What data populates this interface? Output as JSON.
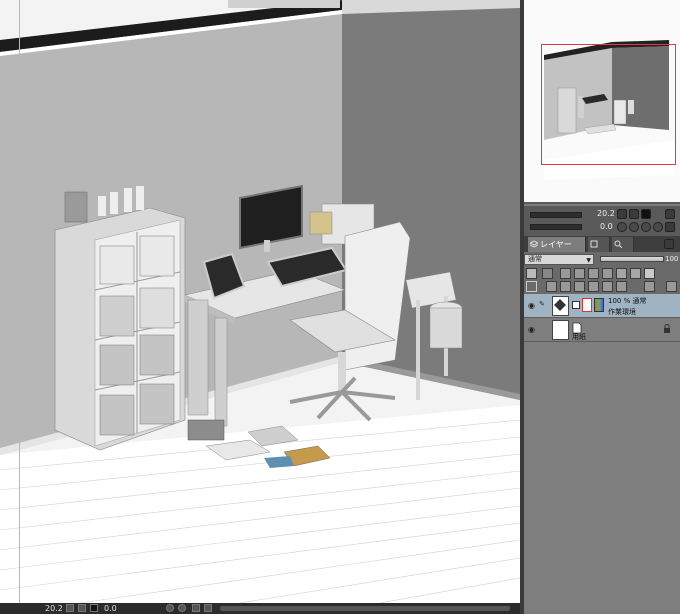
{
  "colors": {
    "canvas_bg": "#f3f3f3",
    "panel_bg": "#7d7d7d",
    "selected_layer": "#9fb3c2",
    "nav_frame": "#e23b3b"
  },
  "statusbar": {
    "zoom": "20.2",
    "rotation": "0.0"
  },
  "navigator": {
    "zoom": "20.2",
    "rotation": "0.0"
  },
  "tabs": [
    {
      "label": "レイヤー",
      "icon": "layers-icon"
    },
    {
      "label": "",
      "icon": "layer-property-icon"
    },
    {
      "label": "",
      "icon": "layer-search-icon"
    }
  ],
  "layer_controls": {
    "blend_mode": "通常",
    "opacity": "100"
  },
  "layers": [
    {
      "opacity_mode": "100 % 通常",
      "name": "作業環境",
      "selected": true
    },
    {
      "opacity_mode": "",
      "name": "用紙",
      "selected": false,
      "locked": true
    }
  ]
}
